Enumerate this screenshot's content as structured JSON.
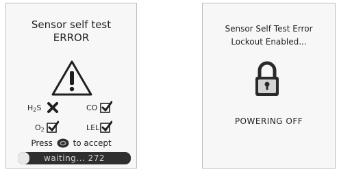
{
  "left_screen": {
    "title_line1": "Sensor self test",
    "title_line2": "ERROR",
    "warning_icon": "warning-triangle-icon",
    "sensors": [
      {
        "label_main": "H",
        "label_sub": "2",
        "label_after": "S",
        "status": "fail",
        "icon": "x-mark-icon"
      },
      {
        "label_main": "CO",
        "label_sub": "",
        "label_after": "",
        "status": "pass",
        "icon": "checkbox-checked-icon"
      },
      {
        "label_main": "O",
        "label_sub": "2",
        "label_after": "",
        "status": "pass",
        "icon": "checkbox-checked-icon"
      },
      {
        "label_main": "LEL",
        "label_sub": "",
        "label_after": "",
        "status": "pass",
        "icon": "checkbox-checked-icon"
      }
    ],
    "press_prefix": "Press",
    "press_suffix": "to accept",
    "button_icon": "button-icon",
    "waiting_text": "waiting... 272",
    "waiting_progress": 0.1
  },
  "right_screen": {
    "title_line1": "Sensor Self Test Error",
    "title_line2": "Lockout Enabled...",
    "lock_icon": "padlock-icon",
    "status_text": "POWERING OFF"
  },
  "colors": {
    "check_fill": "#2a2a2a",
    "screen_bg": "#f7f7f7",
    "bar_bg": "#2f2f2f"
  }
}
